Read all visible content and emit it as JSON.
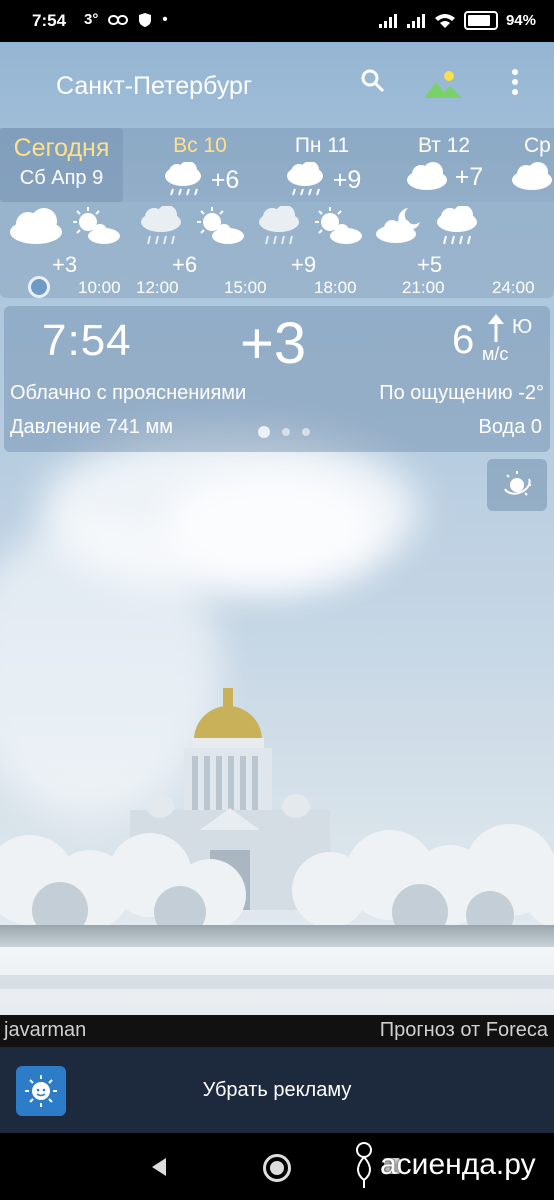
{
  "status_bar": {
    "time": "7:54",
    "temp_indicator": "3°",
    "battery": "94"
  },
  "header": {
    "city": "Санкт-Петербург",
    "icons": [
      "search-icon",
      "landscape-icon",
      "more-vert-icon"
    ],
    "accent_color": "#ffe08a"
  },
  "days": [
    {
      "name": "Сегодня",
      "date": "Сб Апр 9"
    },
    {
      "name": "Вс 10",
      "temp": "+6",
      "icon": "rain-cloud-icon"
    },
    {
      "name": "Пн 11",
      "temp": "+9",
      "icon": "rain-cloud-icon"
    },
    {
      "name": "Вт 12",
      "temp": "+7",
      "icon": "cloud-icon"
    },
    {
      "name": "Ср",
      "icon": "cloud-icon"
    }
  ],
  "hourly": {
    "temps": [
      "+3",
      "+6",
      "+9",
      "+5"
    ],
    "times": [
      "10:00",
      "12:00",
      "15:00",
      "18:00",
      "21:00",
      "24:00"
    ],
    "icons": [
      "cloud-icon",
      "partly-sunny-icon",
      "rain-cloud-icon",
      "partly-sunny-icon",
      "rain-cloud-icon",
      "partly-sunny-icon",
      "night-cloud-icon",
      "rain-cloud-icon"
    ]
  },
  "current": {
    "time": "7:54",
    "temp": "+3",
    "wind_speed": "6",
    "wind_unit": "м/с",
    "wind_dir": "Ю",
    "description": "Облачно с прояснениями",
    "feels_like": "По ощущению -2°",
    "pressure": "Давление 741 мм",
    "water": "Вода 0"
  },
  "credits": {
    "photo_author": "javarman",
    "forecast_source": "Прогноз от Foreca"
  },
  "ad": {
    "label": "Убрать рекламу"
  },
  "watermark": "асиенда.ру"
}
